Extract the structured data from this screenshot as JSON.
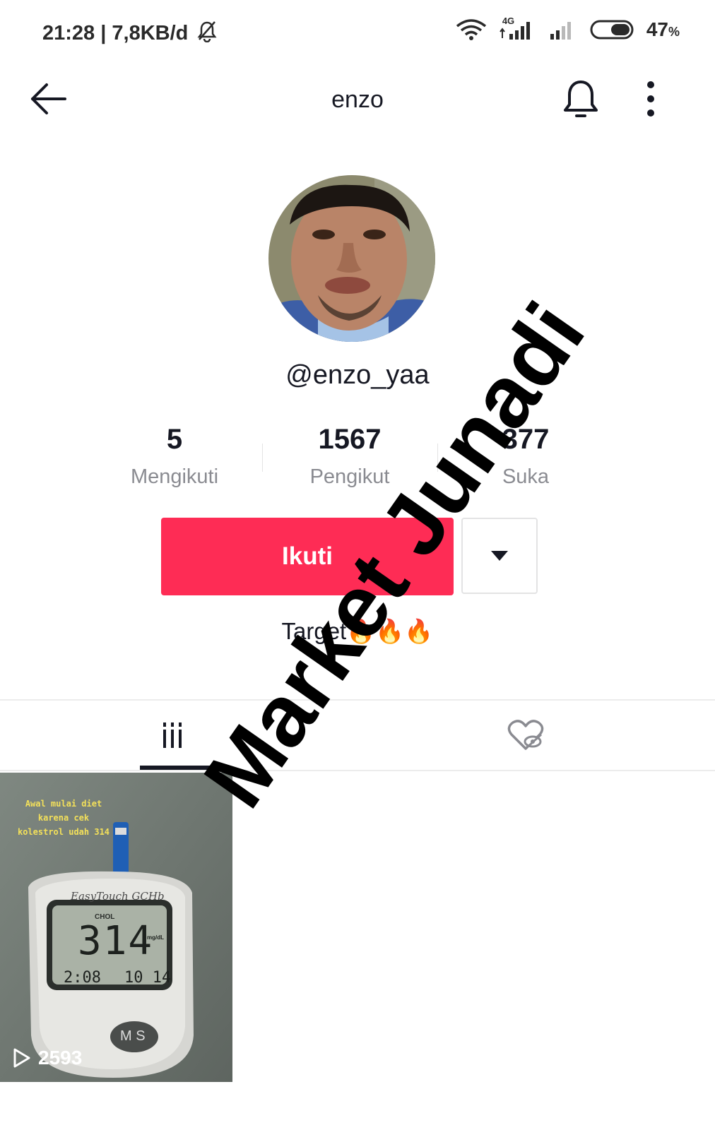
{
  "status_bar": {
    "time_speed": "21:28 | 7,8KB/d",
    "network_label": "4G",
    "battery_percent": "47",
    "battery_unit": "%"
  },
  "header": {
    "title": "enzo",
    "back_icon": "arrow-left-icon",
    "bell_icon": "bell-icon",
    "more_icon": "vertical-dots-icon"
  },
  "profile": {
    "username": "@enzo_yaa",
    "bio": "Target🔥🔥🔥"
  },
  "stats": [
    {
      "value": "5",
      "label": "Mengikuti"
    },
    {
      "value": "1567",
      "label": "Pengikut"
    },
    {
      "value": "377",
      "label": "Suka"
    }
  ],
  "actions": {
    "follow_label": "Ikuti",
    "dropdown_icon": "triangle-down-icon"
  },
  "tabs": {
    "videos_icon": "grid-bars-icon",
    "liked_icon": "heart-hidden-icon"
  },
  "videos": [
    {
      "caption_line1": "Awal mulai diet",
      "caption_line2": "karena cek",
      "caption_line3": "kolestrol udah 314",
      "meter_brand": "EasyTouch GCHb",
      "meter_mode": "CHOL",
      "meter_value": "314",
      "meter_unit": "mg/dL",
      "meter_time": "2:08",
      "meter_date": "10 14",
      "meter_buttons": "M S",
      "views": "2593"
    }
  ],
  "watermark": {
    "text": "Market Junadi"
  },
  "colors": {
    "accent": "#fe2c55",
    "text_primary": "#161823",
    "text_secondary": "#8a8b91"
  }
}
